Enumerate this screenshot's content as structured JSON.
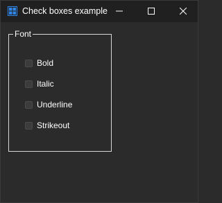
{
  "window": {
    "title": "Check boxes example",
    "icon": "window-app-icon",
    "controls": {
      "minimize_icon": "minimize-icon",
      "maximize_icon": "maximize-icon",
      "close_icon": "close-icon"
    }
  },
  "group": {
    "title": "Font",
    "checkboxes": [
      {
        "label": "Bold",
        "checked": false
      },
      {
        "label": "Italic",
        "checked": false
      },
      {
        "label": "Underline",
        "checked": false
      },
      {
        "label": "Strikeout",
        "checked": false
      }
    ]
  },
  "colors": {
    "titlebar_bg": "#202020",
    "window_bg": "#2b2b2b",
    "text": "#ffffff",
    "groupbox_border": "#d8d8d8",
    "checkbox_fill": "#3c3c3c",
    "app_icon_blue": "#2f86e6"
  }
}
